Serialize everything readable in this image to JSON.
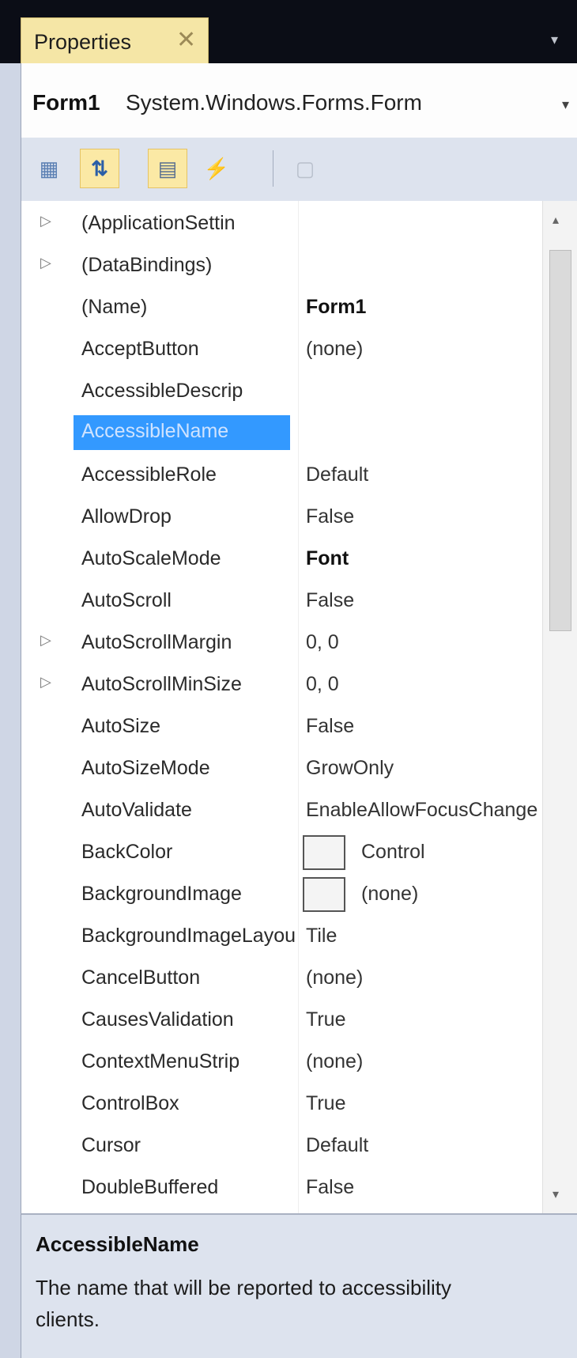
{
  "window": {
    "tab_label": "Properties",
    "tab_close": "✕",
    "tab_menu_icon": "▾"
  },
  "object_selector": {
    "name": "Form1",
    "type": "System.Windows.Forms.Form",
    "dropdown_icon": "▾"
  },
  "toolbar": {
    "buttons": [
      {
        "icon": "categorized-icon",
        "glyph": "▦",
        "active": false
      },
      {
        "icon": "alphabetical-sort-icon",
        "glyph": "⇅",
        "active": true
      },
      {
        "icon": "properties-icon",
        "glyph": "▤",
        "active": true
      },
      {
        "icon": "events-icon",
        "glyph": "⚡",
        "active": false
      },
      {
        "icon": "property-pages-icon",
        "glyph": "▢",
        "active": false
      }
    ]
  },
  "properties": [
    {
      "name": "(ApplicationSettin",
      "value": "",
      "expandable": true
    },
    {
      "name": "(DataBindings)",
      "value": "",
      "expandable": true
    },
    {
      "name": "(Name)",
      "value": "Form1",
      "bold": true
    },
    {
      "name": "AcceptButton",
      "value": "(none)"
    },
    {
      "name": "AccessibleDescrip",
      "value": ""
    },
    {
      "name": "AccessibleName",
      "value": "",
      "selected": true
    },
    {
      "name": "AccessibleRole",
      "value": "Default"
    },
    {
      "name": "AllowDrop",
      "value": "False"
    },
    {
      "name": "AutoScaleMode",
      "value": "Font",
      "bold": true
    },
    {
      "name": "AutoScroll",
      "value": "False"
    },
    {
      "name": "AutoScrollMargin",
      "value": "0, 0",
      "expandable": true
    },
    {
      "name": "AutoScrollMinSize",
      "value": "0, 0",
      "expandable": true
    },
    {
      "name": "AutoSize",
      "value": "False"
    },
    {
      "name": "AutoSizeMode",
      "value": "GrowOnly"
    },
    {
      "name": "AutoValidate",
      "value": "EnableAllowFocusChange"
    },
    {
      "name": "BackColor",
      "value": "Control",
      "swatch": true
    },
    {
      "name": "BackgroundImage",
      "value": "(none)",
      "swatch": true
    },
    {
      "name": "BackgroundImageLayout",
      "value": "Tile"
    },
    {
      "name": "CancelButton",
      "value": "(none)"
    },
    {
      "name": "CausesValidation",
      "value": "True"
    },
    {
      "name": "ContextMenuStrip",
      "value": "(none)"
    },
    {
      "name": "ControlBox",
      "value": "True"
    },
    {
      "name": "Cursor",
      "value": "Default"
    },
    {
      "name": "DoubleBuffered",
      "value": "False"
    }
  ],
  "scrollbar": {
    "up_icon": "▴",
    "down_icon": "▾"
  },
  "description": {
    "title": "AccessibleName",
    "text": "The name that will be reported to accessibility clients."
  },
  "colors": {
    "selection": "#3399ff",
    "tab_active": "#f5e6a6",
    "panel_bg": "#dde3ee"
  }
}
